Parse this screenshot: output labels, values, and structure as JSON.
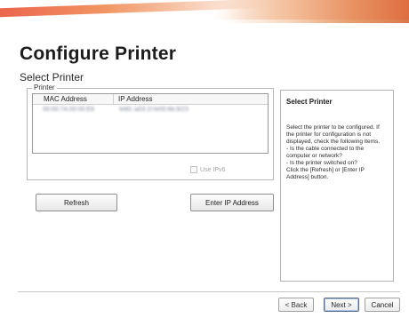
{
  "header": {
    "title": "Configure Printer",
    "subtitle": "Select Printer"
  },
  "printer_group": {
    "label": "Printer",
    "columns": [
      "MAC Address",
      "IP Address"
    ],
    "rows": [
      {
        "mac": "00:00:7A:00:00:E8",
        "ip": "fe80::a03:1f:fe00:6b:9/23"
      }
    ],
    "use_ipv6_label": "Use IPv6"
  },
  "buttons": {
    "refresh": "Refresh",
    "enter_ip": "Enter IP Address"
  },
  "info_panel": {
    "title": "Select Printer",
    "lines": [
      "Select the printer to be configured. If",
      "the printer for configuration is not",
      "displayed, check the following items.",
      "- Is the cable connected to the",
      "computer or network?",
      "- Is the printer switched on?",
      "Click the [Refresh] or [Enter IP",
      "Address] button."
    ]
  },
  "nav": {
    "back": "< Back",
    "next": "Next >",
    "cancel": "Cancel"
  },
  "colors": {
    "accent_orange": "#e9543a",
    "blurred_text": "#7e8a9c"
  }
}
